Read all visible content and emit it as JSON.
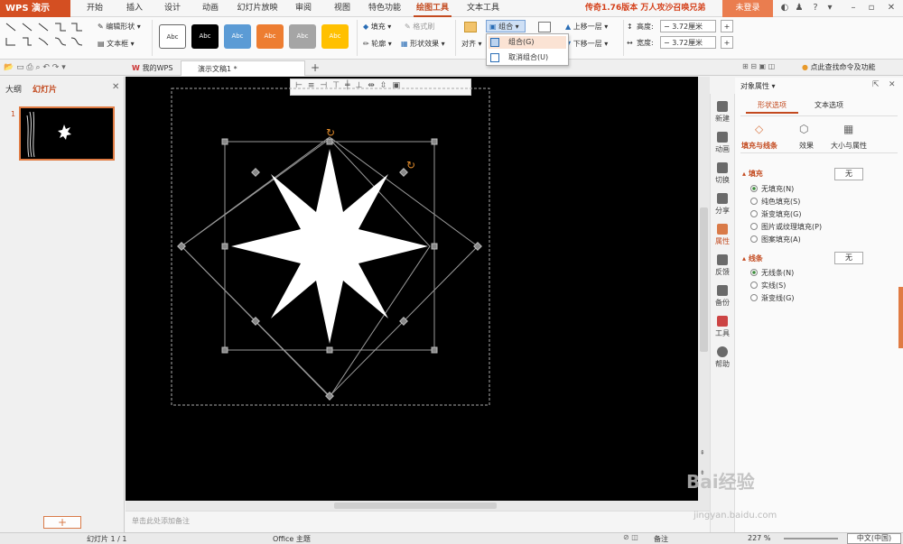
{
  "app": {
    "name": "WPS 演示"
  },
  "menu": [
    "开始",
    "插入",
    "设计",
    "动画",
    "幻灯片放映",
    "审阅",
    "视图",
    "特色功能",
    "绘图工具",
    "文本工具"
  ],
  "menu_active": "绘图工具",
  "promo": "传奇1.76版本 万人攻沙召唤兄弟",
  "login": "未登录",
  "ribbon": {
    "edit_shape": "编辑形状",
    "textbox": "文本框",
    "style_label": "Abc",
    "fill": "填充",
    "format_brush": "格式刷",
    "outline": "轮廓",
    "shape_effect": "形状效果",
    "align": "对齐",
    "group": "组合",
    "bring_forward": "上移一层",
    "send_backward": "下移一层",
    "height_label": "高度:",
    "height_value": "3.72厘米",
    "width_label": "宽度:",
    "width_value": "3.72厘米"
  },
  "group_dropdown": {
    "items": [
      "组合(G)",
      "取消组合(U)"
    ]
  },
  "tabs": {
    "mywps": "我的WPS",
    "doc": "演示文稿1 *",
    "search": "点此查找命令及功能"
  },
  "left_panel": {
    "outline": "大纲",
    "slides": "幻灯片",
    "slide_number": "1"
  },
  "notes_placeholder": "单击此处添加备注",
  "sidebar_items": [
    "新建",
    "动画",
    "切换",
    "分享",
    "属性",
    "反馈",
    "备份",
    "工具",
    "帮助"
  ],
  "props": {
    "title": "对象属性",
    "tab_shape": "形状选项",
    "tab_text": "文本选项",
    "sub_fill_line": "填充与线条",
    "sub_effect": "效果",
    "sub_size": "大小与属性",
    "fill_section": "填充",
    "fill_value": "无",
    "fill_options": [
      "无填充(N)",
      "纯色填充(S)",
      "渐变填充(G)",
      "图片或纹理填充(P)",
      "图案填充(A)"
    ],
    "line_section": "线条",
    "line_value": "无",
    "line_options": [
      "无线条(N)",
      "实线(S)",
      "渐变线(G)"
    ]
  },
  "status": {
    "slide": "幻灯片 1 / 1",
    "theme": "Office 主题",
    "notes": "备注",
    "zoom": "227 %",
    "ime": "中文(中国)"
  },
  "watermark": "Bai经验",
  "watermark_url": "jingyan.baidu.com"
}
